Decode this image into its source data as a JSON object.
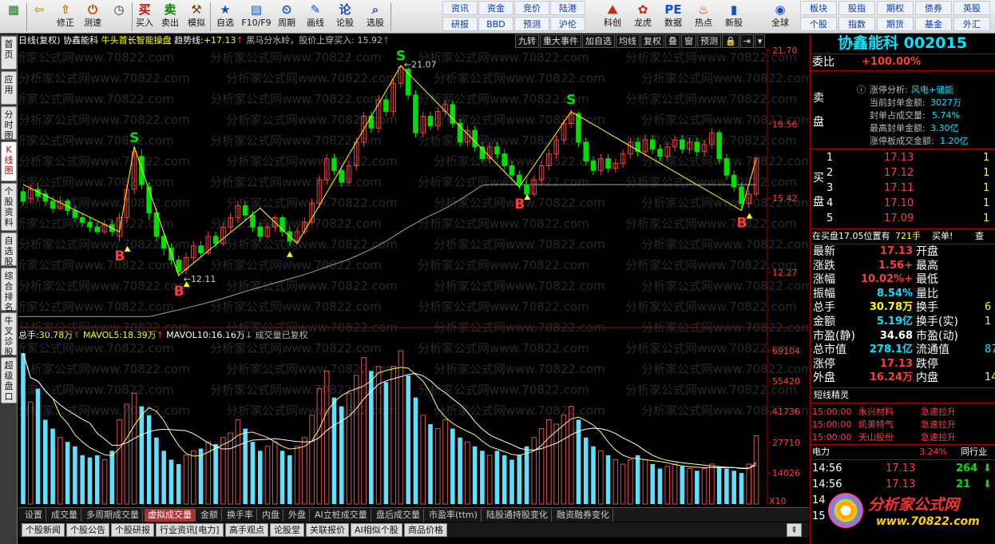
{
  "toolbar": {
    "items": [
      {
        "name": "home-btn",
        "label": "",
        "icon": "▦",
        "color": "#1a7a1a"
      },
      {
        "name": "back-btn",
        "label": "",
        "icon": "⇦",
        "color": "#d89000"
      },
      {
        "name": "fix-btn",
        "label": "修正",
        "icon": "⇧",
        "color": "#b07000"
      },
      {
        "name": "measure-btn",
        "label": "测速",
        "icon": "⏻",
        "color": "#d04000"
      },
      {
        "name": "clock-btn",
        "label": "",
        "icon": "◷",
        "color": "#333"
      },
      {
        "name": "buy-btn",
        "label": "买入",
        "icon": "买",
        "color": "#d00000"
      },
      {
        "name": "sell-btn",
        "label": "卖出",
        "icon": "卖",
        "color": "#008000"
      },
      {
        "name": "sim-btn",
        "label": "模拟",
        "icon": "⚒",
        "color": "#804000"
      },
      {
        "name": "selfsel-btn",
        "label": "自选",
        "icon": "★",
        "color": "#1050c0"
      },
      {
        "name": "f10-btn",
        "label": "F10/F9",
        "icon": "▤",
        "color": "#1050c0"
      },
      {
        "name": "cycle-btn",
        "label": "周期",
        "icon": "⏲",
        "color": "#1050c0"
      },
      {
        "name": "draw-btn",
        "label": "画线",
        "icon": "✎",
        "color": "#1050c0"
      },
      {
        "name": "lunshu-btn",
        "label": "论股",
        "icon": "论",
        "color": "#1050c0"
      },
      {
        "name": "select-btn",
        "label": "选股",
        "icon": "⌕",
        "color": "#1050c0"
      }
    ],
    "mid_tabs": [
      [
        "资讯",
        "研报"
      ],
      [
        "资金",
        "BBD"
      ],
      [
        "竞价",
        "预测"
      ],
      [
        "陆港",
        "沪伦"
      ]
    ],
    "items2": [
      {
        "name": "kechuang-btn",
        "label": "科创",
        "icon": "⛰",
        "color": "#c03000"
      },
      {
        "name": "longhu-btn",
        "label": "龙虎",
        "icon": "✿",
        "color": "#c03000"
      },
      {
        "name": "data-btn",
        "label": "数据",
        "icon": "PE",
        "color": "#1050c0"
      },
      {
        "name": "hot-btn",
        "label": "热点",
        "icon": "♨",
        "color": "#c03000"
      },
      {
        "name": "newstock-btn",
        "label": "新股",
        "icon": "▮",
        "color": "#1050c0"
      },
      {
        "name": "global-btn",
        "label": "全球",
        "icon": "◉",
        "color": "#1050c0"
      }
    ],
    "right_tabs": [
      [
        "板块",
        "个股"
      ],
      [
        "股指",
        "指数"
      ],
      [
        "期权",
        "期货"
      ],
      [
        "债券",
        "基金"
      ],
      [
        "英股",
        "外汇"
      ]
    ]
  },
  "leftnav": [
    "首页",
    "应用",
    "分时图",
    "K线图",
    "个股资料",
    "自选股",
    "综合排名",
    "牛叉诊股",
    "超级盘口"
  ],
  "chart": {
    "header": {
      "period": "日线(复权)",
      "name": "协鑫能科",
      "formula": "牛头首长智能操盘",
      "trend_label": "趋势线:",
      "trend_value": "+17.13",
      "trend_arrow": "↑",
      "text": "黑马分水岭，股价上穿买入: 15.92",
      "text_arrow": "↑"
    },
    "chips": [
      "九转",
      "重大事件",
      "加自选",
      "均线",
      "复权",
      "叠",
      "窗",
      "预测",
      "🔒",
      "⇥",
      "▾"
    ],
    "price_axis": [
      "21.70",
      "18.56",
      "15.42",
      "12.27"
    ],
    "watermark": "分析家公式网www.70822.com",
    "high_label": "21.07",
    "low_label": "12.11",
    "volume_header": {
      "total_label": "总手:",
      "total": "30.78万",
      "ma5_label": "MAVOL5:",
      "ma5": "18.39万",
      "ma10_label": "MAVOL10:",
      "ma10": "16.16万",
      "note": "成交量已复权"
    },
    "volume_axis": [
      "69104",
      "55420",
      "41736",
      "27710",
      "14026"
    ],
    "volume_unit": "X10"
  },
  "chart_data": {
    "type": "candlestick",
    "title": "协鑫能科 日线(复权)",
    "ylim": [
      10.0,
      21.7
    ],
    "candles": [
      [
        15.7,
        15.3,
        15.9,
        15.1
      ],
      [
        15.4,
        15.8,
        16.0,
        15.2
      ],
      [
        15.8,
        15.5,
        16.1,
        15.3
      ],
      [
        15.6,
        15.3,
        15.8,
        15.1
      ],
      [
        15.3,
        15.0,
        15.5,
        14.8
      ],
      [
        15.0,
        15.3,
        15.5,
        14.9
      ],
      [
        15.3,
        14.9,
        15.4,
        14.7
      ],
      [
        14.9,
        14.6,
        15.1,
        14.4
      ],
      [
        14.6,
        14.4,
        14.8,
        14.2
      ],
      [
        14.4,
        14.2,
        14.6,
        14.0
      ],
      [
        14.2,
        14.0,
        14.4,
        13.9
      ],
      [
        14.0,
        14.3,
        14.5,
        13.9
      ],
      [
        14.3,
        14.0,
        14.5,
        13.8
      ],
      [
        13.8,
        14.6,
        14.8,
        13.6
      ],
      [
        14.6,
        15.8,
        16.0,
        14.4
      ],
      [
        15.8,
        17.4,
        17.6,
        15.6
      ],
      [
        17.2,
        16.0,
        17.5,
        15.8
      ],
      [
        15.9,
        14.8,
        16.1,
        14.5
      ],
      [
        14.8,
        13.8,
        15.0,
        13.6
      ],
      [
        13.8,
        13.3,
        14.0,
        13.0
      ],
      [
        13.3,
        12.8,
        13.5,
        12.6
      ],
      [
        12.8,
        12.3,
        13.0,
        12.1
      ],
      [
        12.4,
        12.9,
        13.1,
        12.2
      ],
      [
        12.9,
        13.4,
        13.6,
        12.7
      ],
      [
        13.4,
        13.1,
        13.6,
        12.9
      ],
      [
        13.1,
        13.8,
        14.0,
        13.0
      ],
      [
        13.8,
        13.5,
        14.0,
        13.3
      ],
      [
        13.5,
        14.2,
        14.4,
        13.4
      ],
      [
        14.2,
        14.6,
        14.8,
        14.0
      ],
      [
        14.6,
        15.1,
        15.3,
        14.4
      ],
      [
        15.1,
        14.7,
        15.3,
        14.5
      ],
      [
        14.7,
        14.2,
        14.9,
        14.0
      ],
      [
        14.2,
        13.8,
        14.4,
        13.6
      ],
      [
        13.8,
        14.2,
        14.4,
        13.7
      ],
      [
        14.2,
        14.6,
        14.7,
        14.0
      ],
      [
        14.6,
        14.0,
        14.7,
        13.8
      ],
      [
        14.0,
        13.6,
        14.2,
        13.4
      ],
      [
        13.6,
        14.0,
        14.2,
        13.5
      ],
      [
        14.0,
        14.4,
        14.6,
        13.9
      ],
      [
        14.4,
        15.2,
        15.4,
        14.3
      ],
      [
        15.2,
        16.2,
        16.4,
        15.0
      ],
      [
        16.2,
        17.1,
        17.3,
        16.0
      ],
      [
        17.1,
        16.6,
        17.3,
        16.4
      ],
      [
        16.6,
        16.1,
        16.8,
        15.9
      ],
      [
        16.1,
        16.8,
        17.0,
        16.0
      ],
      [
        16.8,
        17.8,
        18.0,
        16.6
      ],
      [
        17.8,
        18.9,
        19.1,
        17.6
      ],
      [
        18.9,
        18.4,
        19.1,
        18.2
      ],
      [
        18.4,
        19.6,
        19.8,
        18.2
      ],
      [
        19.6,
        19.1,
        19.8,
        18.9
      ],
      [
        19.1,
        20.3,
        20.5,
        18.9
      ],
      [
        20.3,
        21.0,
        21.07,
        20.1
      ],
      [
        20.9,
        19.8,
        21.0,
        19.6
      ],
      [
        19.8,
        18.2,
        20.0,
        18.0
      ],
      [
        18.2,
        18.9,
        19.1,
        18.0
      ],
      [
        18.9,
        18.5,
        19.1,
        18.3
      ],
      [
        18.5,
        19.1,
        19.3,
        18.3
      ],
      [
        19.1,
        19.4,
        19.6,
        18.9
      ],
      [
        19.4,
        18.6,
        19.6,
        18.4
      ],
      [
        18.6,
        17.8,
        18.8,
        17.6
      ],
      [
        17.8,
        18.3,
        18.5,
        17.6
      ],
      [
        18.3,
        17.6,
        18.5,
        17.4
      ],
      [
        17.6,
        17.1,
        17.8,
        16.9
      ],
      [
        17.1,
        17.6,
        17.8,
        16.9
      ],
      [
        17.6,
        17.3,
        17.8,
        17.1
      ],
      [
        17.3,
        16.8,
        17.5,
        16.6
      ],
      [
        16.8,
        16.4,
        17.0,
        16.2
      ],
      [
        16.4,
        16.0,
        16.6,
        15.8
      ],
      [
        16.0,
        15.6,
        16.2,
        15.4
      ],
      [
        15.6,
        16.2,
        16.4,
        15.5
      ],
      [
        16.2,
        16.8,
        17.0,
        16.0
      ],
      [
        16.8,
        17.3,
        17.5,
        16.6
      ],
      [
        17.3,
        17.9,
        18.1,
        17.1
      ],
      [
        17.9,
        18.6,
        18.8,
        17.7
      ],
      [
        18.6,
        19.0,
        19.2,
        18.4
      ],
      [
        19.0,
        17.8,
        19.1,
        17.6
      ],
      [
        17.8,
        17.0,
        18.0,
        16.8
      ],
      [
        17.0,
        16.6,
        17.2,
        16.4
      ],
      [
        16.6,
        17.1,
        17.3,
        16.4
      ],
      [
        17.1,
        16.7,
        17.3,
        16.5
      ],
      [
        16.7,
        16.9,
        17.1,
        16.5
      ],
      [
        16.9,
        17.3,
        17.5,
        16.7
      ],
      [
        17.3,
        17.8,
        18.0,
        17.1
      ],
      [
        17.8,
        17.4,
        18.0,
        17.2
      ],
      [
        17.4,
        17.9,
        18.1,
        17.2
      ],
      [
        17.9,
        17.5,
        18.1,
        17.3
      ],
      [
        17.5,
        17.2,
        17.7,
        17.0
      ],
      [
        17.2,
        17.6,
        17.8,
        17.0
      ],
      [
        17.6,
        17.9,
        18.1,
        17.4
      ],
      [
        17.9,
        17.5,
        18.1,
        17.3
      ],
      [
        17.5,
        17.8,
        18.0,
        17.3
      ],
      [
        17.8,
        17.4,
        18.0,
        17.2
      ],
      [
        17.4,
        17.7,
        17.9,
        17.2
      ],
      [
        17.7,
        18.2,
        18.4,
        17.5
      ],
      [
        18.2,
        17.1,
        18.3,
        16.9
      ],
      [
        17.1,
        16.4,
        17.3,
        16.2
      ],
      [
        16.4,
        15.9,
        16.6,
        15.7
      ],
      [
        15.9,
        15.2,
        16.1,
        15.0
      ],
      [
        15.2,
        15.6,
        15.8,
        15.0
      ],
      [
        15.6,
        17.13,
        17.13,
        15.5
      ]
    ],
    "volumes": [
      68000,
      46000,
      52000,
      38000,
      34000,
      30000,
      28000,
      26000,
      22000,
      21000,
      22000,
      20000,
      24000,
      38000,
      45000,
      50000,
      44000,
      40000,
      30000,
      24000,
      20000,
      18000,
      22000,
      24000,
      25000,
      28000,
      27000,
      30000,
      32000,
      38000,
      34000,
      28000,
      24000,
      26000,
      28000,
      24000,
      22000,
      26000,
      30000,
      40000,
      52000,
      60000,
      48000,
      44000,
      50000,
      58000,
      66000,
      60000,
      62000,
      55000,
      62000,
      69104,
      58000,
      48000,
      40000,
      36000,
      34000,
      38000,
      34000,
      30000,
      28000,
      26000,
      24000,
      22000,
      24000,
      22000,
      20000,
      22000,
      26000,
      30000,
      34000,
      38000,
      36000,
      40000,
      44000,
      38000,
      30000,
      26000,
      24000,
      22000,
      20000,
      18000,
      20000,
      22000,
      20000,
      18000,
      16000,
      17000,
      18000,
      17000,
      16000,
      15000,
      16000,
      18000,
      17000,
      16000,
      15000,
      14000,
      18000,
      30780
    ],
    "bs_signals": [
      {
        "i": 15,
        "type": "S"
      },
      {
        "i": 13,
        "type": "B"
      },
      {
        "i": 21,
        "type": "B"
      },
      {
        "i": 51,
        "type": "S"
      },
      {
        "i": 67,
        "type": "B"
      },
      {
        "i": 74,
        "type": "S"
      },
      {
        "i": 97,
        "type": "B"
      }
    ]
  },
  "bottom_tabs": [
    "设置",
    "成交量",
    "多周期成交量",
    "虚拟成交量",
    "金额",
    "换手率",
    "内盘",
    "外盘",
    "AI立桩成交量",
    "盘后成交量",
    "市盈率(ttm)",
    "陆股通持股变化",
    "融资融券变化"
  ],
  "bottom_tabs2": [
    "个股新闻",
    "个股公告",
    "个股研报",
    "行业资讯[电力]",
    "高手观点",
    "论股堂",
    "关联报价",
    "AI相似个股",
    "商品价格"
  ],
  "panel": {
    "title": "协鑫能科 002015",
    "weibi_label": "委比",
    "weibi_value": "+100.00%",
    "zt": {
      "title": "涨停分析:",
      "concept": "风电+储能",
      "rows": [
        [
          "当前封单金额:",
          "3027万"
        ],
        [
          "封单占成交量:",
          "5.74%"
        ],
        [
          "最高封单金额:",
          "3.30亿"
        ],
        [
          "涨停板成交金额:",
          "1.20亿"
        ]
      ]
    },
    "sell_label": "卖盘",
    "buy_label": "买盘",
    "buy": [
      [
        "1",
        "17.13"
      ],
      [
        "2",
        "17.12"
      ],
      [
        "3",
        "17.11"
      ],
      [
        "4",
        "17.10"
      ],
      [
        "5",
        "17.09"
      ]
    ],
    "notice": {
      "text": "在买盘17.05位置有",
      "vol": "721手",
      "act": "买单!",
      "btn": "查"
    },
    "quote": [
      [
        "最新",
        "17.13",
        "开盘",
        ""
      ],
      [
        "涨跌",
        "+1.56",
        "最高",
        ""
      ],
      [
        "涨幅",
        "+10.02%",
        "最低",
        ""
      ],
      [
        "振幅",
        "8.54%",
        "量比",
        ""
      ],
      [
        "总手",
        "30.78万",
        "换手",
        "6"
      ],
      [
        "金额",
        "5.19亿",
        "换手(实)",
        "1"
      ],
      [
        "市盈(静)",
        "34.68",
        "市盈(动)",
        ""
      ],
      [
        "总市值",
        "278.1亿",
        "流通值",
        "87"
      ],
      [
        "涨停",
        "17.13",
        "跌停",
        ""
      ],
      [
        "外盘",
        "16.24万",
        "内盘",
        "14"
      ]
    ],
    "shortline": {
      "title": "短线精灵",
      "rows": [
        [
          "15:00:00",
          "永兴材料",
          "急速拉升"
        ],
        [
          "15:00:00",
          "凯美特气",
          "急速拉升"
        ],
        [
          "15:00:00",
          "天山股份",
          "急速拉升"
        ]
      ]
    },
    "industry": {
      "name": "电力",
      "pct": "3.24%",
      "note": "同行业"
    },
    "ticks": [
      [
        "14:56",
        "17.13",
        "264"
      ],
      [
        "14:56",
        "17.13",
        "21"
      ],
      [
        "14",
        ""
      ],
      [
        "15",
        ""
      ]
    ],
    "logo": "分析家公式网",
    "logo_url": "www.70822.com"
  }
}
